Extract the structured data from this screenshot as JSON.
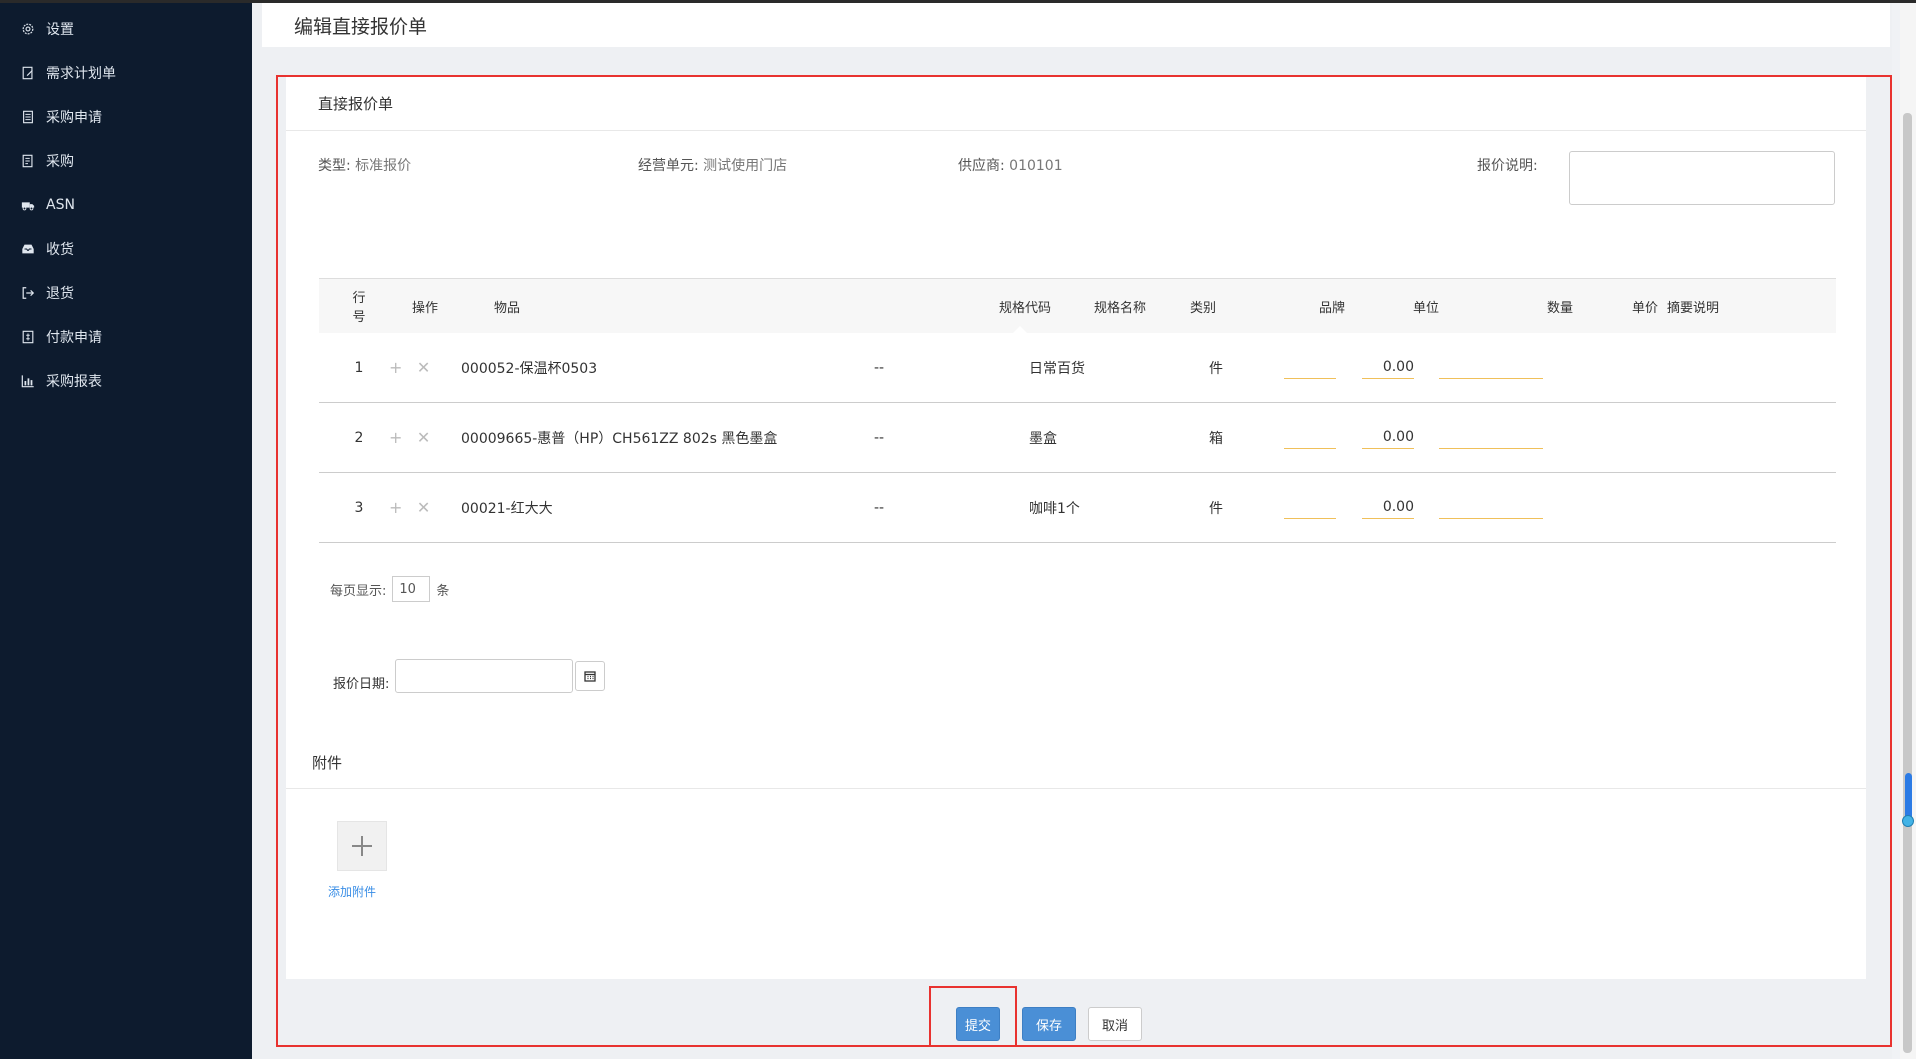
{
  "sidebar": {
    "items": [
      {
        "label": "设置",
        "icon": "gear-icon"
      },
      {
        "label": "需求计划单",
        "icon": "edit-doc-icon"
      },
      {
        "label": "采购申请",
        "icon": "doc-icon"
      },
      {
        "label": "采购",
        "icon": "list-doc-icon"
      },
      {
        "label": "ASN",
        "icon": "truck-icon"
      },
      {
        "label": "收货",
        "icon": "inbox-icon"
      },
      {
        "label": "退货",
        "icon": "sign-out-icon"
      },
      {
        "label": "付款申请",
        "icon": "file-dollar-icon"
      },
      {
        "label": "采购报表",
        "icon": "bar-chart-icon"
      }
    ]
  },
  "page": {
    "title": "编辑直接报价单"
  },
  "form": {
    "card_title": "直接报价单",
    "type_label": "类型:",
    "type_value": "标准报价",
    "unit_label": "经营单元:",
    "unit_value": "测试使用门店",
    "supplier_label": "供应商:",
    "supplier_value": "010101",
    "remark_label": "报价说明:",
    "remark_value": ""
  },
  "table": {
    "headers": {
      "no": "行号",
      "op": "操作",
      "item": "物品",
      "code": "规格代码",
      "name": "规格名称",
      "category": "类别",
      "brand": "品牌",
      "unit": "单位",
      "qty": "数量",
      "price": "单价",
      "desc": "摘要说明"
    },
    "rows": [
      {
        "no": "1",
        "item": "000052-保温杯0503",
        "code": "--",
        "name": "",
        "category": "日常百货",
        "brand": "",
        "unit": "件",
        "qty": "",
        "price": "0.00",
        "desc": ""
      },
      {
        "no": "2",
        "item": "00009665-惠普（HP）CH561ZZ 802s 黑色墨盒",
        "code": "--",
        "name": "",
        "category": "墨盒",
        "brand": "",
        "unit": "箱",
        "qty": "",
        "price": "0.00",
        "desc": ""
      },
      {
        "no": "3",
        "item": "00021-红大大",
        "code": "--",
        "name": "",
        "category": "咖啡1个",
        "brand": "",
        "unit": "件",
        "qty": "",
        "price": "0.00",
        "desc": ""
      }
    ],
    "add_symbol": "+",
    "remove_symbol": "✕"
  },
  "pager": {
    "prefix": "每页显示:",
    "size": "10",
    "suffix": "条"
  },
  "date": {
    "label": "报价日期:",
    "value": ""
  },
  "attachments": {
    "title": "附件",
    "add_label": "添加附件"
  },
  "buttons": {
    "submit": "提交",
    "save": "保存",
    "cancel": "取消"
  },
  "colors": {
    "sidebar_bg": "#0d1b2e",
    "primary": "#4a8fd6",
    "highlight": "#e8322f",
    "input_underline": "#f0c05a"
  }
}
